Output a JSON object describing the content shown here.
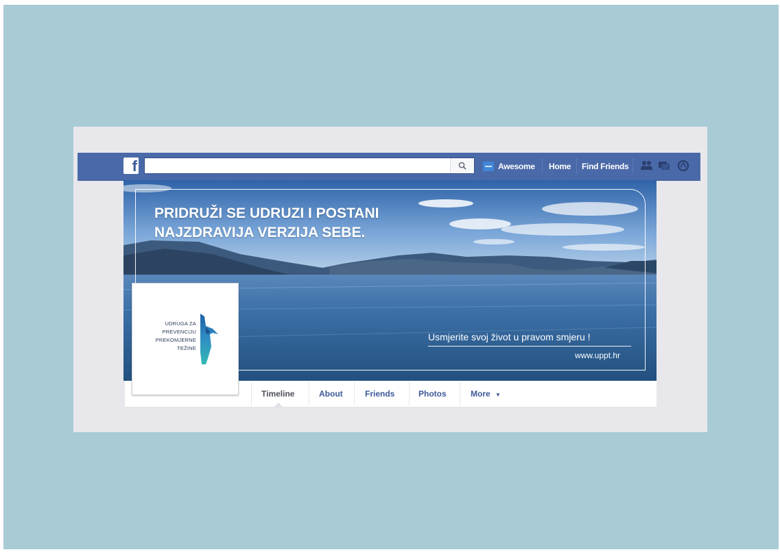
{
  "topbar": {
    "logo_text": "f",
    "search_placeholder": "",
    "user_name": "Awesome",
    "home_label": "Home",
    "find_friends_label": "Find Friends",
    "icons": [
      "friend-requests-icon",
      "messages-icon",
      "notifications-icon"
    ]
  },
  "cover": {
    "headline_line1": "PRIDRUŽI SE UDRUZI I POSTANI",
    "headline_line2": "NAJZDRAVIJA VERZIJA SEBE.",
    "tagline": "Usmjerite svoj život u pravom smjeru !",
    "website": "www.uppt.hr"
  },
  "profile": {
    "org_line1": "UDRUGA ZA",
    "org_line2": "PREVENCIJU",
    "org_line3": "PREKOMJERNE",
    "org_line4": "TEŽINE"
  },
  "tabs": [
    {
      "label": "Timeline"
    },
    {
      "label": "About"
    },
    {
      "label": "Friends"
    },
    {
      "label": "Photos"
    },
    {
      "label": "More"
    }
  ],
  "colors": {
    "backdrop": "#a9cbd6",
    "facebook_blue": "#4a69a8",
    "link_blue": "#3b5998"
  }
}
